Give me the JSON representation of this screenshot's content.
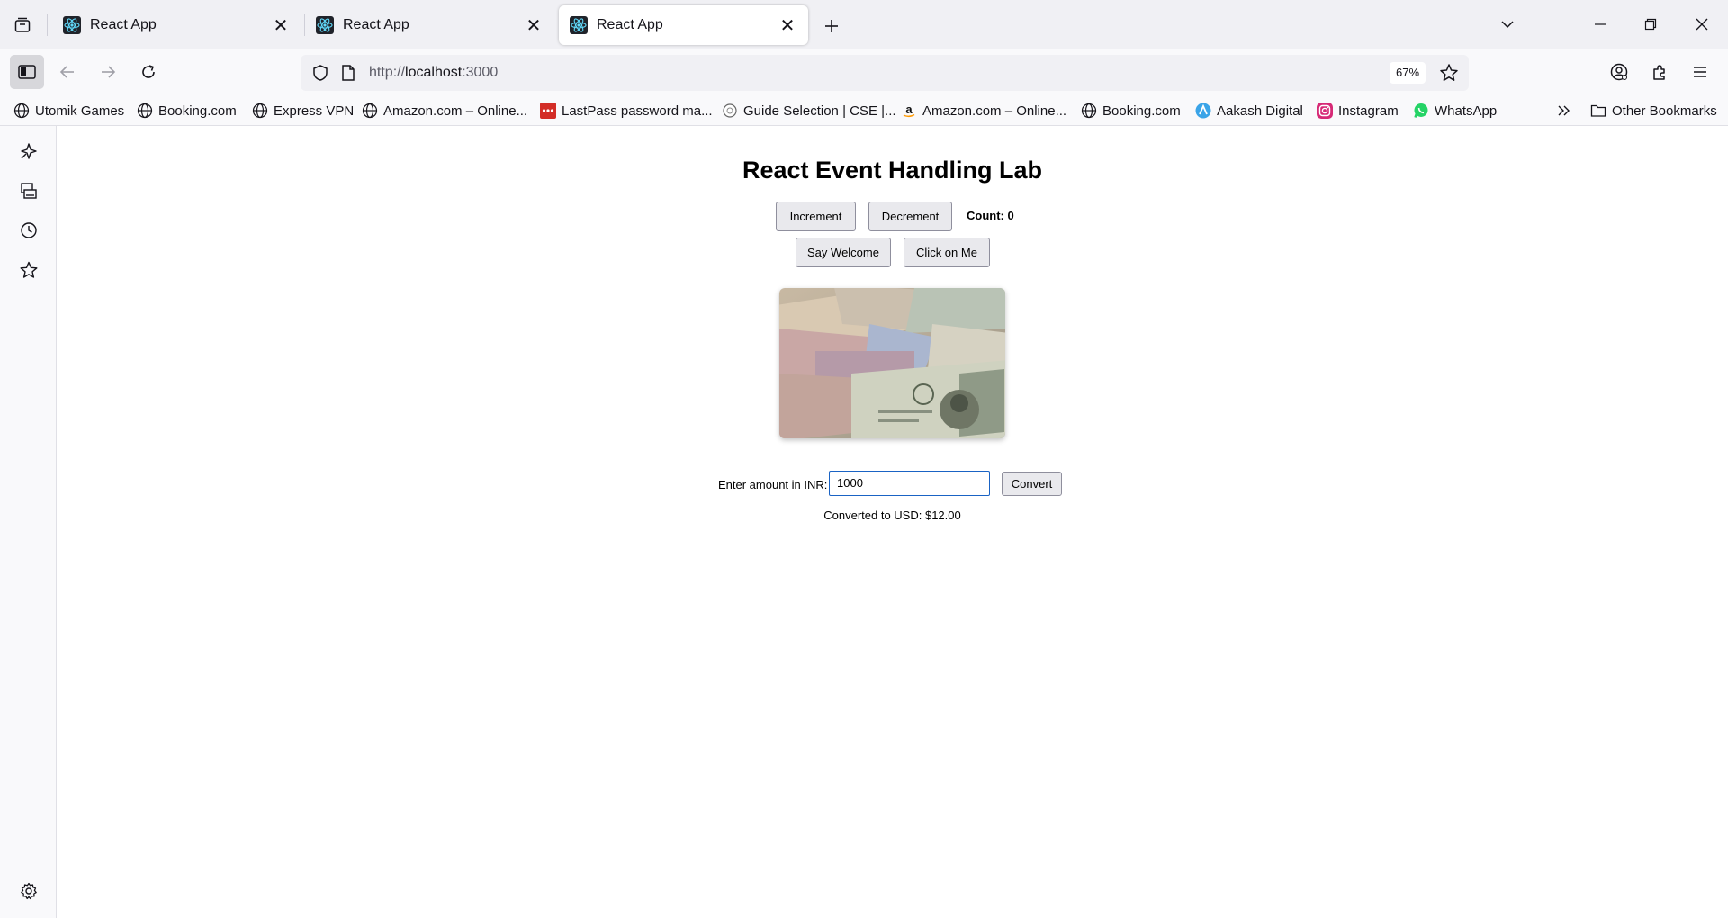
{
  "browser": {
    "tabs": [
      {
        "title": "React App",
        "active": false
      },
      {
        "title": "React App",
        "active": false
      },
      {
        "title": "React App",
        "active": true
      }
    ],
    "url_prefix": "http://",
    "url_host": "localhost",
    "url_suffix": ":3000",
    "zoom": "67%",
    "bookmarks": [
      {
        "label": "Utomik Games",
        "icon": "globe-icon"
      },
      {
        "label": "Booking.com",
        "icon": "globe-icon"
      },
      {
        "label": "Express VPN",
        "icon": "globe-icon"
      },
      {
        "label": "Amazon.com – Online...",
        "icon": "globe-icon"
      },
      {
        "label": "LastPass password ma...",
        "icon": "lastpass-icon"
      },
      {
        "label": "Guide Selection | CSE |...",
        "icon": "guide-icon"
      },
      {
        "label": "Amazon.com – Online...",
        "icon": "amazon-icon"
      },
      {
        "label": "Booking.com",
        "icon": "globe-icon"
      },
      {
        "label": "Aakash Digital",
        "icon": "aakash-icon"
      },
      {
        "label": "Instagram",
        "icon": "instagram-icon"
      },
      {
        "label": "WhatsApp",
        "icon": "whatsapp-icon"
      }
    ],
    "other_bookmarks": "Other Bookmarks"
  },
  "app": {
    "title": "React Event Handling Lab",
    "increment_label": "Increment",
    "decrement_label": "Decrement",
    "count_text": "Count: 0",
    "welcome_label": "Say Welcome",
    "click_label": "Click on Me",
    "amount_label": "Enter amount in INR:",
    "amount_value": "1000",
    "convert_label": "Convert",
    "result_text": "Converted to USD: $12.00"
  },
  "colors": {
    "accent": "#1a63c4",
    "button_bg": "#e9e9ed"
  }
}
